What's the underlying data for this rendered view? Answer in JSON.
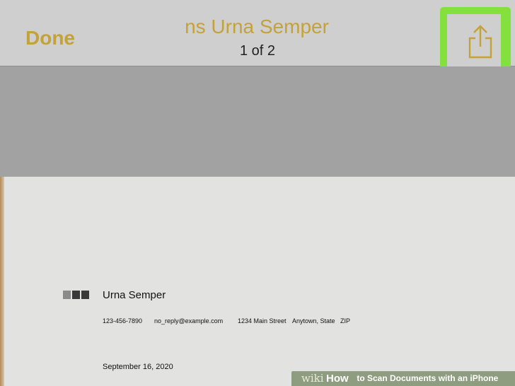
{
  "nav_bar": {
    "done_label": "Done",
    "title": "ns Urna Semper",
    "page_counter": "1 of 2",
    "share_icon": "share-icon"
  },
  "colors": {
    "accent": "#c4a23a",
    "nav_background": "#cfcfcf",
    "highlight": "#84e03c",
    "gray_band": "#a2a2a2",
    "page_background": "#e2e2e1"
  },
  "document": {
    "logo_block_colors": [
      "#8b8b8b",
      "#3a3a3a",
      "#3a3a3a"
    ],
    "name": "Urna Semper",
    "phone": "123-456-7890",
    "email": "no_reply@example.com",
    "address": "1234 Main Street",
    "city_state_zip": "Anytown, State   ZIP",
    "date": "September 16, 2020"
  },
  "watermark": {
    "wiki": "wiki",
    "how": "How",
    "rest": " to Scan Documents with an iPhone"
  }
}
